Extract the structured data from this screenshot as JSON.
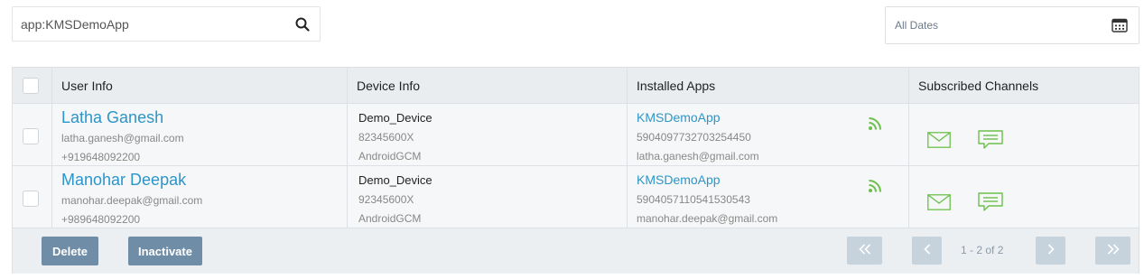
{
  "search": {
    "value": "app:KMSDemoApp",
    "icon": "search-icon"
  },
  "date_filter": {
    "label": "All Dates",
    "icon": "calendar-icon"
  },
  "table": {
    "headers": {
      "user_info": "User Info",
      "device_info": "Device Info",
      "installed_apps": "Installed Apps",
      "subscribed_channels": "Subscribed Channels"
    },
    "rows": [
      {
        "user_name": "Latha Ganesh",
        "user_email": "latha.ganesh@gmail.com",
        "user_phone": "+919648092200",
        "device_name": "Demo_Device",
        "device_id": "82345600X",
        "device_platform": "AndroidGCM",
        "app_name": "KMSDemoApp",
        "app_id": "5904097732703254450",
        "app_user": "latha.ganesh@gmail.com"
      },
      {
        "user_name": "Manohar Deepak",
        "user_email": "manohar.deepak@gmail.com",
        "user_phone": "+989648092200",
        "device_name": "Demo_Device",
        "device_id": "92345600X",
        "device_platform": "AndroidGCM",
        "app_name": "KMSDemoApp",
        "app_id": "5904057110541530543",
        "app_user": "manohar.deepak@gmail.com"
      }
    ]
  },
  "footer": {
    "delete_label": "Delete",
    "inactivate_label": "Inactivate",
    "page_info": "1 - 2 of 2"
  },
  "colors": {
    "link": "#2c95c9",
    "channel_green": "#6cc04a",
    "button": "#6f8da6",
    "pager_button": "#c6d2dc"
  }
}
